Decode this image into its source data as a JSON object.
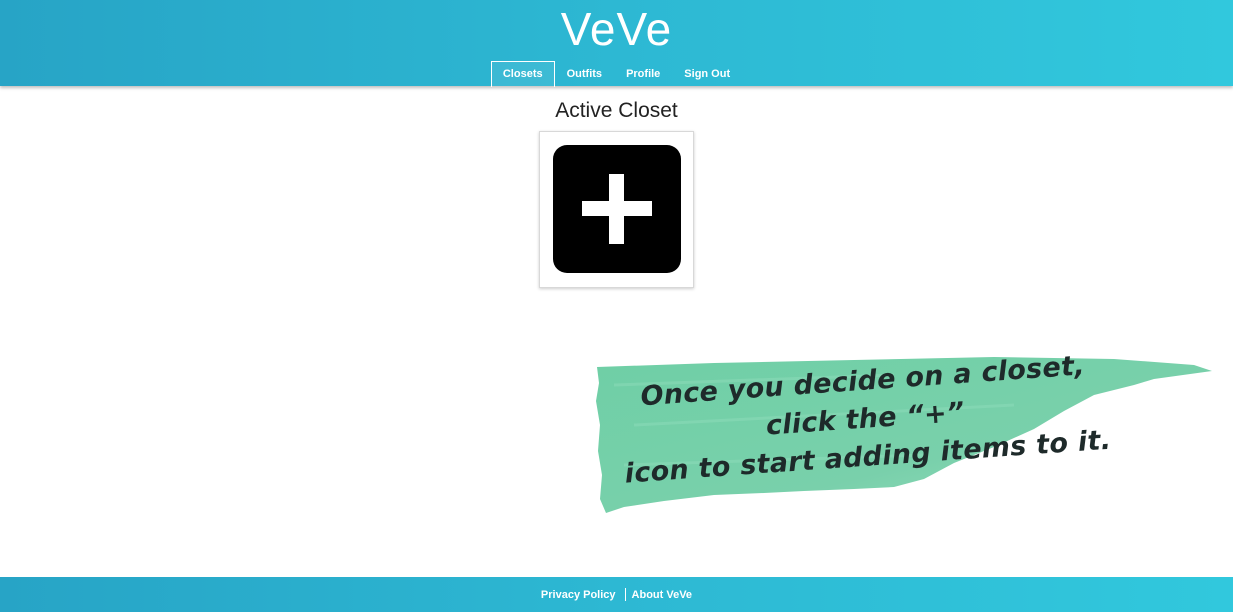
{
  "header": {
    "brand": "VeVe",
    "nav": [
      {
        "label": "Closets",
        "active": true
      },
      {
        "label": "Outfits",
        "active": false
      },
      {
        "label": "Profile",
        "active": false
      },
      {
        "label": "Sign Out",
        "active": false
      }
    ]
  },
  "main": {
    "title": "Active Closet",
    "add_tile_icon": "plus-icon"
  },
  "callout": {
    "line1": "Once you decide on a closet, click the “+”",
    "line2": "icon to start adding items to it.",
    "color": "#6fcfa6"
  },
  "footer": {
    "links": [
      "Privacy Policy",
      "About VeVe"
    ]
  },
  "colors": {
    "header_gradient_start": "#27a4c6",
    "header_gradient_end": "#31c8dd"
  }
}
